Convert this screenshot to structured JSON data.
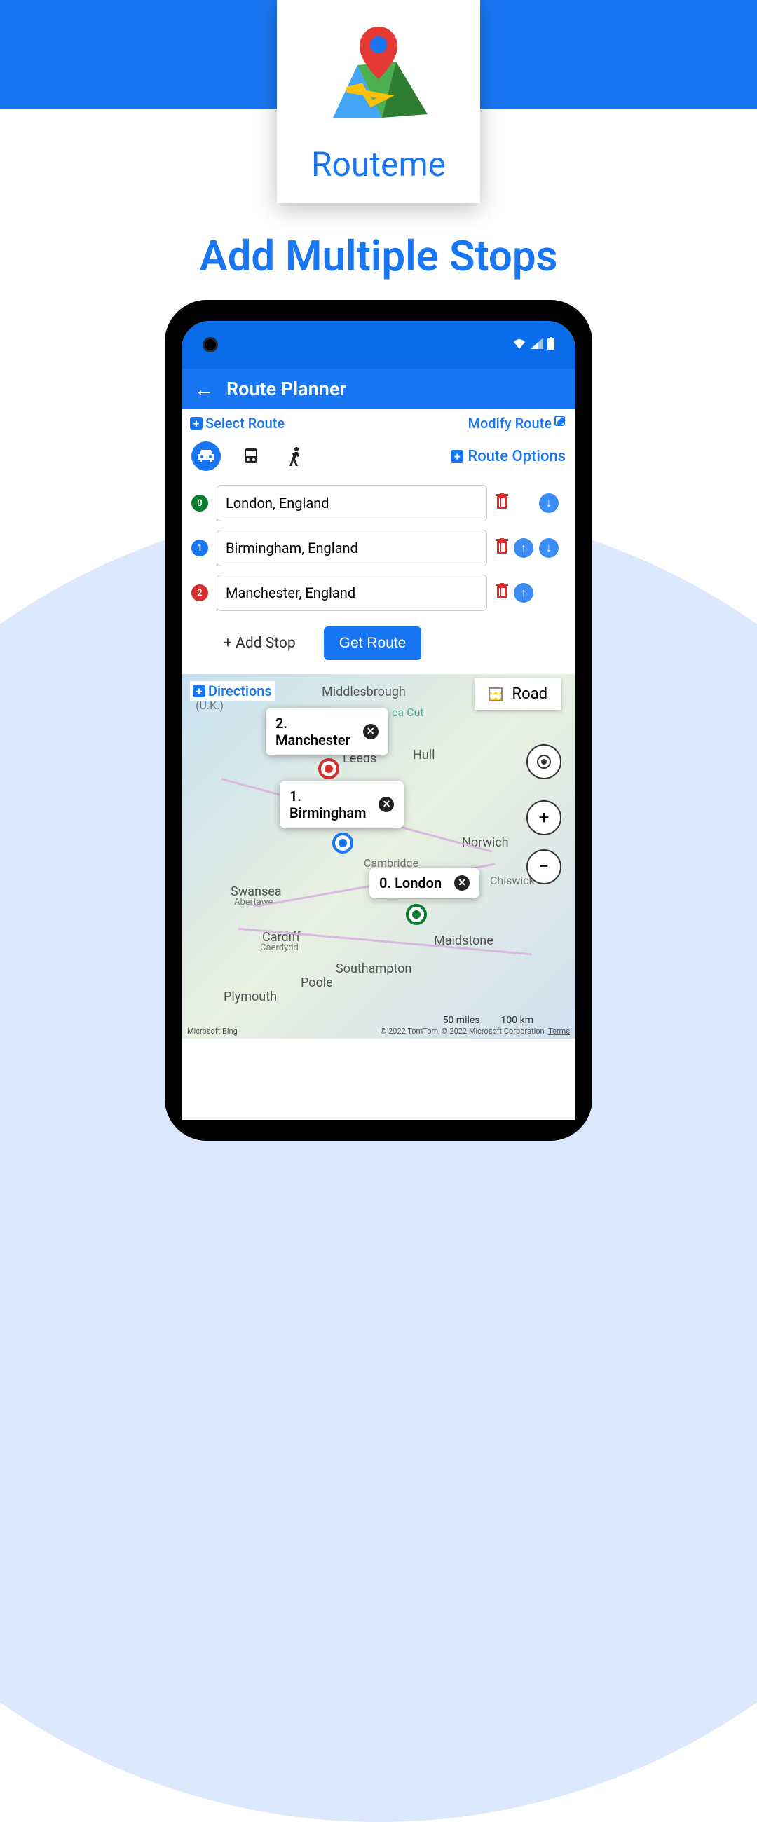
{
  "app_name": "Routeme",
  "headline": "Add Multiple Stops",
  "app_bar": {
    "title": "Route Planner"
  },
  "top_actions": {
    "select_route": "Select Route",
    "modify_route": "Modify Route"
  },
  "route_options": "Route Options",
  "stops": [
    {
      "index": "0",
      "location": "London, England"
    },
    {
      "index": "1",
      "location": "Birmingham, England"
    },
    {
      "index": "2",
      "location": "Manchester, England"
    }
  ],
  "add_stop": "+ Add Stop",
  "get_route": "Get Route",
  "directions": "Directions",
  "map_type": "Road",
  "callouts": [
    {
      "text": "2. Manchester"
    },
    {
      "text": "1. Birmingham"
    },
    {
      "text": "0. London"
    }
  ],
  "map_labels": {
    "middlesbrough": "Middlesbrough",
    "uk": "(U.K.)",
    "leeds": "Leeds",
    "hull": "Hull",
    "norwich": "Norwich",
    "cambridge": "Cambridge",
    "swansea": "Swansea",
    "abertawe": "Abertawe",
    "cardiff": "Cardiff",
    "caerdydd": "Caerdydd",
    "maidstone": "Maidstone",
    "southampton": "Southampton",
    "poole": "Poole",
    "plymouth": "Plymouth",
    "chiswick": "Chiswick",
    "ea_cut": "ea Cut"
  },
  "scale": {
    "miles": "50 miles",
    "km": "100 km"
  },
  "attribution": {
    "left": "Microsoft Bing",
    "right": "© 2022 TomTom, © 2022 Microsoft Corporation",
    "terms": "Terms"
  }
}
